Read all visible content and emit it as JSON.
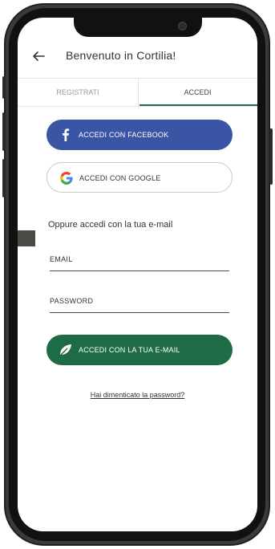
{
  "header": {
    "title": "Benvenuto in Cortilia!",
    "back_icon": "arrow-left-icon"
  },
  "tabs": [
    {
      "label": "REGISTRATI",
      "active": false
    },
    {
      "label": "ACCEDI",
      "active": true
    }
  ],
  "social": {
    "facebook_label": "ACCEDI CON FACEBOOK",
    "google_label": "ACCEDI CON GOOGLE"
  },
  "or_text": "Oppure accedi con la tua e-mail",
  "form": {
    "email_label": "EMAIL",
    "password_label": "PASSWORD"
  },
  "email_button_label": "ACCEDI CON LA TUA E-MAIL",
  "forgot_password": "Hai dimenticato la password?",
  "colors": {
    "facebook": "#3b55a5",
    "brand_green": "#1e6b47",
    "text": "#333333"
  }
}
